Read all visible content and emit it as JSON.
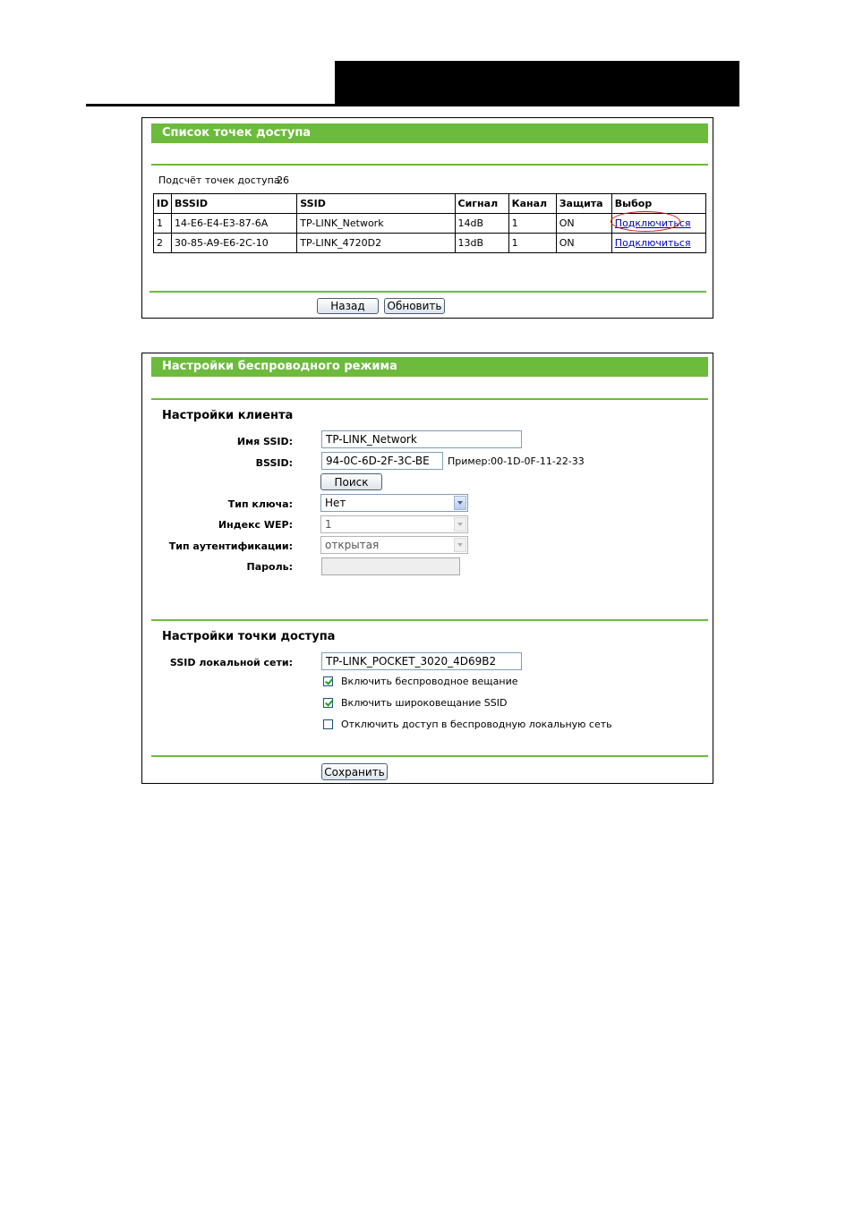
{
  "ap_list": {
    "title": "Список точек доступа",
    "count_label": "Подсчёт точек доступа:",
    "count_value": "26",
    "columns": [
      "ID",
      "BSSID",
      "SSID",
      "Сигнал",
      "Канал",
      "Защита",
      "Выбор"
    ],
    "rows": [
      {
        "id": "1",
        "bssid": "14-E6-E4-E3-87-6A",
        "ssid": "TP-LINK_Network",
        "signal": "14dB",
        "channel": "1",
        "security": "ON",
        "action": "Подключиться"
      },
      {
        "id": "2",
        "bssid": "30-85-A9-E6-2C-10",
        "ssid": "TP-LINK_4720D2",
        "signal": "13dB",
        "channel": "1",
        "security": "ON",
        "action": "Подключиться"
      }
    ],
    "back_label": "Назад",
    "refresh_label": "Обновить"
  },
  "wireless": {
    "title": "Настройки беспроводного режима",
    "client_section": "Настройки клиента",
    "ssid_label": "Имя SSID:",
    "ssid_value": "TP-LINK_Network",
    "bssid_label": "BSSID:",
    "bssid_value": "94-0C-6D-2F-3C-BE",
    "bssid_example": "Пример:00-1D-0F-11-22-33",
    "search_label": "Поиск",
    "key_type_label": "Тип ключа:",
    "key_type_value": "Нет",
    "wep_index_label": "Индекс WEP:",
    "wep_index_value": "1",
    "auth_type_label": "Тип аутентификации:",
    "auth_type_value": "открытая",
    "password_label": "Пароль:",
    "password_value": "",
    "ap_section": "Настройки точки доступа",
    "local_ssid_label": "SSID локальной сети:",
    "local_ssid_value": "TP-LINK_POCKET_3020_4D69B2",
    "cb_broadcast_label": "Включить беспроводное вещание",
    "cb_ssid_broadcast_label": "Включить широковещание SSID",
    "cb_disable_access_label": "Отключить доступ в беспроводную локальную сеть",
    "save_label": "Сохранить"
  },
  "colors": {
    "accent_green": "#6cbb3c",
    "link_blue": "#0000cc",
    "highlight_red": "#d8141d"
  }
}
